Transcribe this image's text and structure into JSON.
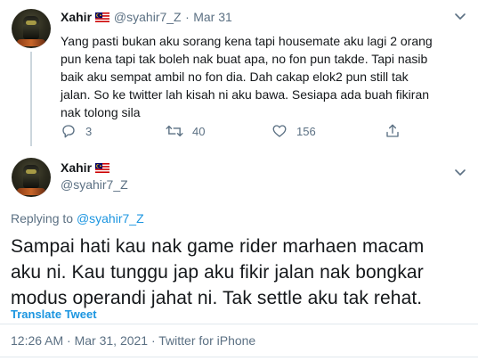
{
  "tweet1": {
    "name": "Xahir",
    "handle": "@syahir7_Z",
    "separator": "·",
    "date": "Mar 31",
    "text_lines": [
      "Yang pasti bukan aku sorang kena tapi housemate aku lagi 2 orang",
      "pun kena tapi tak boleh nak buat apa, no fon pun takde. Tapi nasib",
      "baik aku sempat ambil no fon dia. Dah cakap elok2 pun still tak",
      "jalan. So ke twitter lah kisah ni aku bawa. Sesiapa ada buah fikiran",
      "nak tolong sila"
    ],
    "replies": "3",
    "retweets": "40",
    "likes": "156"
  },
  "tweet2": {
    "name": "Xahir",
    "handle": "@syahir7_Z",
    "replying_prefix": "Replying to",
    "replying_handle": "@syahir7_Z",
    "text_lines": [
      "Sampai hati kau nak game rider marhaen macam",
      "aku ni. Kau tunggu jap aku fikir jalan nak bongkar",
      "modus operandi jahat ni. Tak settle aku tak rehat."
    ],
    "translate_label": "Translate Tweet",
    "timestamp": "12:26 AM · Mar 31, 2021 · Twitter for iPhone"
  },
  "icons": [
    "avatar",
    "malaysia-flag-icon",
    "chevron-down-icon",
    "reply-icon",
    "retweet-icon",
    "like-icon",
    "share-icon"
  ],
  "colors": {
    "link": "#1b95e0",
    "secondary_text": "#5b7083",
    "divider": "#e1e8ed"
  }
}
